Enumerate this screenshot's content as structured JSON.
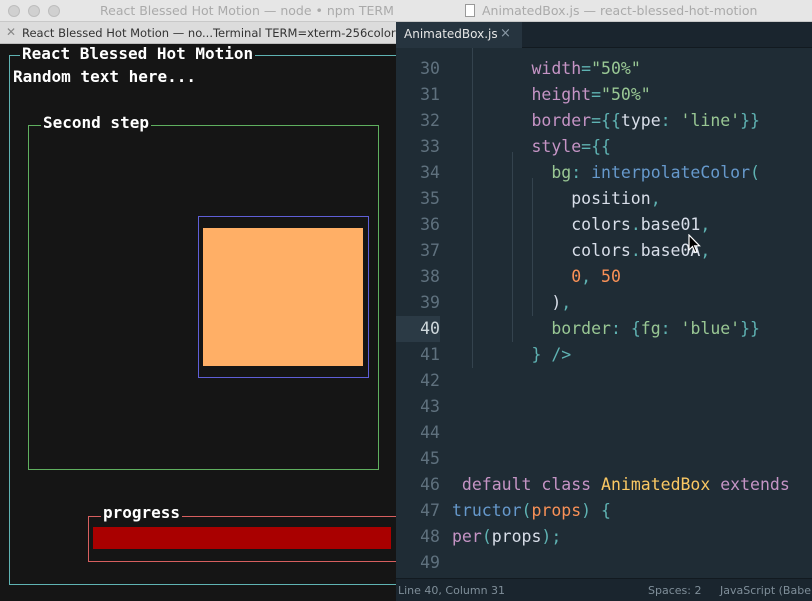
{
  "terminal": {
    "window_title": "React Blessed Hot Motion — node • npm TERM",
    "tab_label": "React Blessed Hot Motion — no...Terminal TERM=xterm-256color",
    "main_box_label": "React Blessed Hot Motion",
    "random_text": "Random text here...",
    "step_box_label": "Second step",
    "progress_label": "progress",
    "progress_fraction": 0.985,
    "colors": {
      "main_border": "#5fb3b3",
      "step_border": "#5faf5f",
      "inner_border": "#5f5fd7",
      "animated_fill": "#ffaf66",
      "progress_border": "#d75f5f",
      "progress_fill": "#a90000"
    }
  },
  "editor": {
    "window_title": "AnimatedBox.js — react-blessed-hot-motion",
    "tab_label": "AnimatedBox.js",
    "tab_close": "×",
    "active_line": 40,
    "lines": [
      {
        "n": "30",
        "tokens": [
          [
            "attr",
            "        width"
          ],
          [
            "punc",
            "="
          ],
          [
            "str",
            "\"50%\""
          ]
        ]
      },
      {
        "n": "31",
        "tokens": [
          [
            "attr",
            "        height"
          ],
          [
            "punc",
            "="
          ],
          [
            "str",
            "\"50%\""
          ]
        ]
      },
      {
        "n": "32",
        "tokens": [
          [
            "attr",
            "        border"
          ],
          [
            "punc",
            "={{"
          ],
          [
            "plain",
            "type"
          ],
          [
            "punc",
            ": "
          ],
          [
            "str",
            "'line'"
          ],
          [
            "punc",
            "}}"
          ]
        ]
      },
      {
        "n": "33",
        "tokens": [
          [
            "attr",
            "        style"
          ],
          [
            "punc",
            "={{"
          ]
        ]
      },
      {
        "n": "34",
        "tokens": [
          [
            "plain",
            "          "
          ],
          [
            "str",
            "bg"
          ],
          [
            "punc",
            ": "
          ],
          [
            "fn",
            "interpolateColor"
          ],
          [
            "punc",
            "("
          ]
        ]
      },
      {
        "n": "35",
        "tokens": [
          [
            "plain",
            "            position"
          ],
          [
            "punc",
            ","
          ]
        ]
      },
      {
        "n": "36",
        "tokens": [
          [
            "plain",
            "            colors"
          ],
          [
            "punc",
            "."
          ],
          [
            "plain",
            "base01"
          ],
          [
            "punc",
            ","
          ]
        ]
      },
      {
        "n": "37",
        "tokens": [
          [
            "plain",
            "            colors"
          ],
          [
            "punc",
            "."
          ],
          [
            "plain",
            "base0A"
          ],
          [
            "punc",
            ","
          ]
        ]
      },
      {
        "n": "38",
        "tokens": [
          [
            "plain",
            "            "
          ],
          [
            "num",
            "0"
          ],
          [
            "punc",
            ", "
          ],
          [
            "num",
            "50"
          ]
        ]
      },
      {
        "n": "39",
        "tokens": [
          [
            "plain",
            "          )"
          ],
          [
            "punc",
            ","
          ]
        ]
      },
      {
        "n": "40",
        "tokens": [
          [
            "plain",
            "          "
          ],
          [
            "str",
            "border"
          ],
          [
            "punc",
            ": {"
          ],
          [
            "str",
            "fg"
          ],
          [
            "punc",
            ": "
          ],
          [
            "str",
            "'blue'"
          ],
          [
            "punc",
            "}}"
          ]
        ]
      },
      {
        "n": "41",
        "tokens": [
          [
            "punc",
            "        } />"
          ]
        ]
      },
      {
        "n": "42",
        "tokens": []
      },
      {
        "n": "43",
        "tokens": []
      },
      {
        "n": "44",
        "tokens": []
      },
      {
        "n": "45",
        "tokens": []
      },
      {
        "n": "46",
        "tokens": [
          [
            "kw",
            " default"
          ],
          [
            "plain",
            " "
          ],
          [
            "kw",
            "class"
          ],
          [
            "plain",
            " "
          ],
          [
            "cls",
            "AnimatedBox"
          ],
          [
            "plain",
            " "
          ],
          [
            "kw",
            "extends"
          ]
        ]
      },
      {
        "n": "47",
        "tokens": [
          [
            "fn",
            "tructor"
          ],
          [
            "punc",
            "("
          ],
          [
            "num",
            "props"
          ],
          [
            "punc",
            ") {"
          ]
        ]
      },
      {
        "n": "48",
        "tokens": [
          [
            "attr",
            "per"
          ],
          [
            "punc",
            "("
          ],
          [
            "plain",
            "props"
          ],
          [
            "punc",
            ");"
          ]
        ]
      },
      {
        "n": "49",
        "tokens": []
      }
    ],
    "status": {
      "position": "Line 40, Column 31",
      "spaces": "Spaces: 2",
      "syntax": "JavaScript (Babel)"
    }
  }
}
